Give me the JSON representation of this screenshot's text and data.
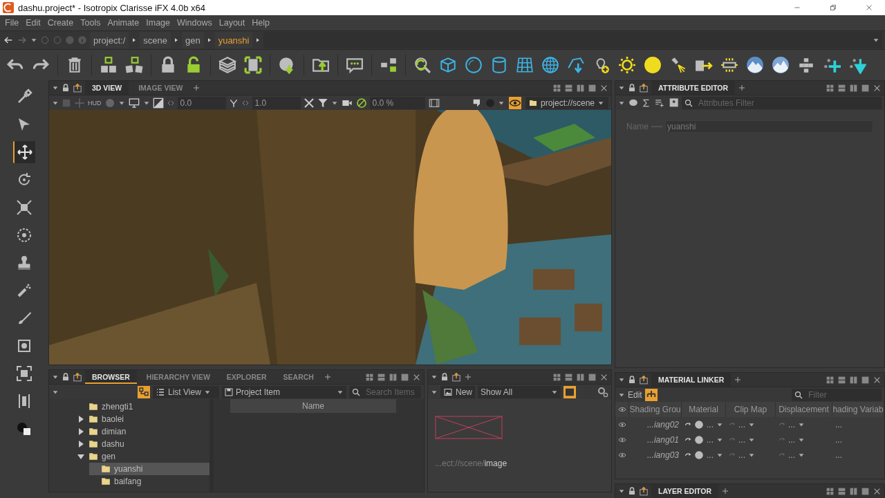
{
  "window": {
    "title": "dashu.project* - Isotropix Clarisse iFX 4.0b x64"
  },
  "menu": [
    "File",
    "Edit",
    "Create",
    "Tools",
    "Animate",
    "Image",
    "Windows",
    "Layout",
    "Help"
  ],
  "path": [
    {
      "label": "project:/",
      "selected": false
    },
    {
      "label": "scene",
      "selected": false
    },
    {
      "label": "gen",
      "selected": false
    },
    {
      "label": "yuanshi",
      "selected": true
    }
  ],
  "tools": [
    {
      "selected": false
    },
    {
      "selected": false
    },
    {
      "selected": true
    },
    {
      "selected": false
    },
    {
      "selected": false
    },
    {
      "selected": false
    },
    {
      "selected": false
    },
    {
      "selected": false
    },
    {
      "selected": false
    },
    {
      "selected": false
    },
    {
      "selected": false
    },
    {
      "selected": false
    },
    {
      "selected": false
    }
  ],
  "viewport_panel": {
    "tabs": [
      {
        "label": "3D VIEW",
        "selected": true
      },
      {
        "label": "IMAGE VIEW",
        "selected": false
      }
    ],
    "hud": "HUD",
    "exposure": "0.0",
    "gamma": "1.0",
    "zoom": "0.0 %",
    "context": "project://scene"
  },
  "attribute_editor": {
    "tabs": [
      {
        "label": "ATTRIBUTE EDITOR",
        "selected": true
      }
    ],
    "filter_placeholder": "Attributes Filter",
    "name_label": "Name",
    "name_value": "yuanshi"
  },
  "browser": {
    "tabs": [
      {
        "label": "BROWSER",
        "selected": true
      },
      {
        "label": "HIERARCHY VIEW",
        "selected": false
      },
      {
        "label": "EXPLORER",
        "selected": false
      },
      {
        "label": "SEARCH",
        "selected": false
      }
    ],
    "view_mode": "List View",
    "item_type": "Project Item",
    "search_placeholder": "Search Items",
    "tree": [
      {
        "label": "zhengti1",
        "selected": false
      },
      {
        "label": "baolei",
        "expanded": false,
        "selected": false
      },
      {
        "label": "dimian",
        "expanded": false,
        "selected": false
      },
      {
        "label": "dashu",
        "expanded": false,
        "selected": false
      },
      {
        "label": "gen",
        "expanded": true,
        "selected": false,
        "children": [
          {
            "label": "yuanshi",
            "selected": true
          },
          {
            "label": "baifang",
            "selected": false
          }
        ]
      }
    ],
    "columns": [
      "Name"
    ]
  },
  "image_panel": {
    "new_label": "New",
    "filter": "Show All",
    "path_prefix": "...ect://scene/",
    "path_tail": "image"
  },
  "material_linker": {
    "tabs": [
      {
        "label": "MATERIAL LINKER",
        "selected": true
      }
    ],
    "edit_label": "Edit",
    "filter_placeholder": "Filter",
    "columns": [
      "Shading Grou",
      "Material",
      "Clip Map",
      "Displacement",
      "hading Variab"
    ],
    "rows": [
      {
        "cells": [
          "...iang02",
          "...",
          "...",
          "...",
          "..."
        ]
      },
      {
        "cells": [
          "...iang01",
          "...",
          "...",
          "...",
          "..."
        ]
      },
      {
        "cells": [
          "...iang03",
          "...",
          "...",
          "...",
          "..."
        ]
      }
    ]
  },
  "layer_editor": {
    "tabs": [
      {
        "label": "LAYER EDITOR",
        "selected": true
      }
    ]
  }
}
